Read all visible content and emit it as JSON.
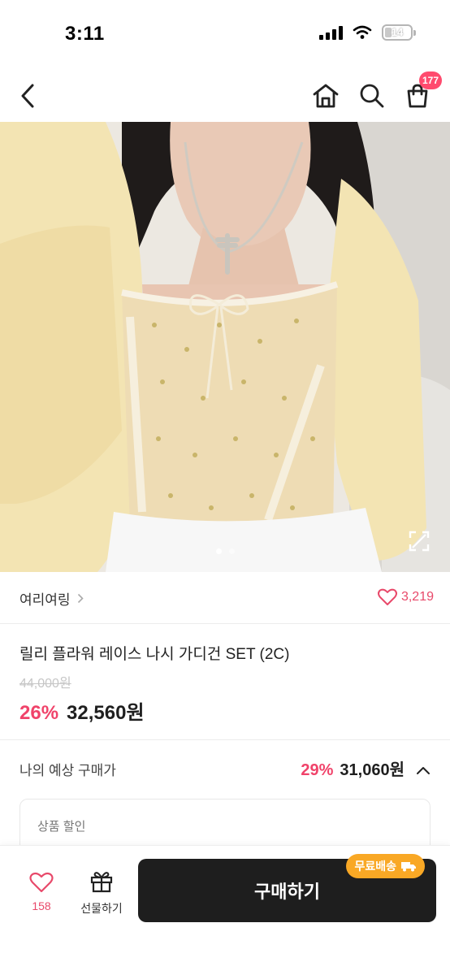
{
  "status_bar": {
    "time": "3:11",
    "battery": "14"
  },
  "nav": {
    "cart_count": "177",
    "icons": [
      "back-icon",
      "home-icon",
      "search-icon",
      "cart-icon"
    ]
  },
  "carousel": {
    "page_count": 2,
    "current_page": 1
  },
  "brand": {
    "name": "여리여링",
    "likes": "3,219"
  },
  "product": {
    "title": "릴리 플라워 레이스 나시 가디건 SET (2C)",
    "original_price": "44,000원",
    "discount": "26%",
    "sale_price": "32,560원"
  },
  "expected": {
    "label": "나의 예상 구매가",
    "discount": "29%",
    "price": "31,060원"
  },
  "discount_card": {
    "title": "상품 할인"
  },
  "bottom_bar": {
    "like_count": "158",
    "gift_label": "선물하기",
    "buy_label": "구매하기",
    "free_shipping": "무료배송"
  },
  "colors": {
    "accent": "#f0436a",
    "badge": "#ff4b6e",
    "free_shipping": "#f9a825",
    "buy_button": "#1e1e1e"
  }
}
